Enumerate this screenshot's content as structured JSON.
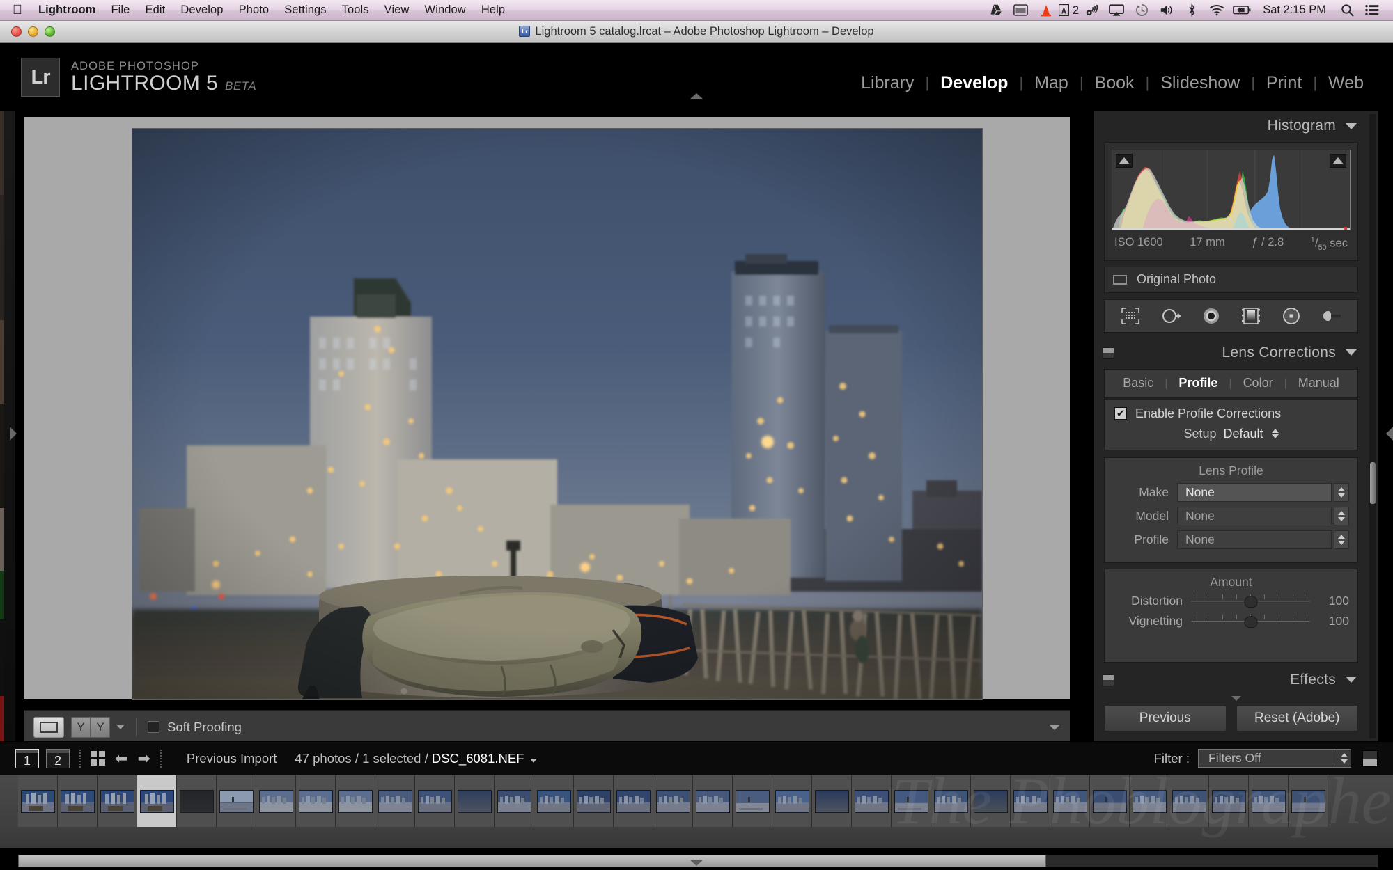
{
  "macbar": {
    "apple_icon": "apple-icon",
    "app_name": "Lightroom",
    "menus": [
      "File",
      "Edit",
      "Develop",
      "Photo",
      "Settings",
      "Tools",
      "View",
      "Window",
      "Help"
    ],
    "status_icons": [
      "google-drive-icon",
      "display-icon",
      "cone-icon",
      "adobe-icon",
      "airport-utility-icon",
      "airplay-icon",
      "time-machine-icon",
      "volume-icon",
      "bluetooth-icon",
      "wifi-icon",
      "battery-icon"
    ],
    "adobe_badge_count": "2",
    "clock": "Sat 2:15 PM",
    "search_icon": "search-icon",
    "notification_icon": "notification-list-icon"
  },
  "titlebar": {
    "title": "Lightroom 5 catalog.lrcat – Adobe Photoshop Lightroom – Develop",
    "close": "close-button",
    "minimize": "minimize-button",
    "zoom": "zoom-button"
  },
  "identity": {
    "badge": "Lr",
    "line1": "ADOBE PHOTOSHOP",
    "line2": "LIGHTROOM 5",
    "beta": "BETA"
  },
  "modules": {
    "items": [
      "Library",
      "Develop",
      "Map",
      "Book",
      "Slideshow",
      "Print",
      "Web"
    ],
    "active": "Develop"
  },
  "histogram": {
    "title": "Histogram",
    "iso": "ISO 1600",
    "focal": "17 mm",
    "aperture": "ƒ / 2.8",
    "shutter_num": "1",
    "shutter_den": "50",
    "shutter_unit": "sec",
    "shadow_clip": "shadow-clipping-toggle",
    "highlight_clip": "highlight-clipping-toggle"
  },
  "original_photo": {
    "label": "Original Photo"
  },
  "tools": {
    "items": [
      "crop-overlay-tool",
      "spot-removal-tool",
      "red-eye-correction-tool",
      "graduated-filter-tool",
      "radial-filter-tool",
      "adjustment-brush-tool"
    ]
  },
  "lens_corrections": {
    "title": "Lens Corrections",
    "tabs": [
      "Basic",
      "Profile",
      "Color",
      "Manual"
    ],
    "active_tab": "Profile",
    "enable_label": "Enable Profile Corrections",
    "enable_checked": true,
    "setup_label": "Setup",
    "setup_value": "Default",
    "lens_profile_title": "Lens Profile",
    "fields": [
      {
        "label": "Make",
        "value": "None"
      },
      {
        "label": "Model",
        "value": "None"
      },
      {
        "label": "Profile",
        "value": "None"
      }
    ],
    "amount_title": "Amount",
    "sliders": [
      {
        "label": "Distortion",
        "value": "100",
        "pos": 50
      },
      {
        "label": "Vignetting",
        "value": "100",
        "pos": 50
      }
    ]
  },
  "effects": {
    "title": "Effects"
  },
  "right_buttons": {
    "previous": "Previous",
    "reset": "Reset (Adobe)"
  },
  "toolbar": {
    "view_mode": "loupe-view-button",
    "before_after": [
      "Y",
      "Y"
    ],
    "soft_proofing_label": "Soft Proofing",
    "soft_proofing_checked": false
  },
  "filmstrip_bar": {
    "screen1": "1",
    "screen2": "2",
    "grid_icon": "grid-view-icon",
    "back_icon": "go-back-icon",
    "forward_icon": "go-forward-icon",
    "source": "Previous Import",
    "count": "47 photos / 1 selected / ",
    "filename": "DSC_6081.NEF",
    "filter_label": "Filter :",
    "filter_value": "Filters Off"
  },
  "filmstrip": {
    "selected_index": 3,
    "thumbs": [
      {
        "sky": "#2d4a74",
        "ground": "#6d7384",
        "kind": "city"
      },
      {
        "sky": "#2e4a78",
        "ground": "#5c6274",
        "kind": "city"
      },
      {
        "sky": "#2d4878",
        "ground": "#5a6072",
        "kind": "city"
      },
      {
        "sky": "#2d4878",
        "ground": "#5a6072",
        "kind": "city"
      },
      {
        "sky": "#232528",
        "ground": "#2a2c30",
        "kind": "dark"
      },
      {
        "sky": "#8c9ab0",
        "ground": "#6e7687",
        "kind": "pier"
      },
      {
        "sky": "#5b6e90",
        "ground": "#8e93a0",
        "kind": "skyline"
      },
      {
        "sky": "#5b6e90",
        "ground": "#8e93a0",
        "kind": "skyline"
      },
      {
        "sky": "#5b6e90",
        "ground": "#8e93a0",
        "kind": "skyline"
      },
      {
        "sky": "#4a5c7e",
        "ground": "#7e8493",
        "kind": "skyline"
      },
      {
        "sky": "#3e5178",
        "ground": "#6a707f",
        "kind": "skyline"
      },
      {
        "sky": "#2f3f5e",
        "ground": "#4c525f",
        "kind": "dark"
      },
      {
        "sky": "#3a4c70",
        "ground": "#7a8090",
        "kind": "skyline"
      },
      {
        "sky": "#39537f",
        "ground": "#707684",
        "kind": "skyline"
      },
      {
        "sky": "#2e4169",
        "ground": "#5f6574",
        "kind": "skyline"
      },
      {
        "sky": "#32456d",
        "ground": "#6a7080",
        "kind": "skyline"
      },
      {
        "sky": "#3d5175",
        "ground": "#767c8c",
        "kind": "skyline"
      },
      {
        "sky": "#46597c",
        "ground": "#7d8393",
        "kind": "skyline"
      },
      {
        "sky": "#4a5d80",
        "ground": "#828896",
        "kind": "pier"
      },
      {
        "sky": "#49628c",
        "ground": "#6e7484",
        "kind": "skyline"
      },
      {
        "sky": "#2a3a5c",
        "ground": "#4e545f",
        "kind": "dark"
      },
      {
        "sky": "#3b4f78",
        "ground": "#6f7583",
        "kind": "skyline"
      },
      {
        "sky": "#44597f",
        "ground": "#7a8090",
        "kind": "pier"
      },
      {
        "sky": "#3f5578",
        "ground": "#737988",
        "kind": "skyline"
      },
      {
        "sky": "#2b3c5e",
        "ground": "#4a5057",
        "kind": "dark"
      },
      {
        "sky": "#3c5178",
        "ground": "#767c8a",
        "kind": "skyline"
      },
      {
        "sky": "#41567d",
        "ground": "#7b8190",
        "kind": "skyline"
      },
      {
        "sky": "#3a4e74",
        "ground": "#6c727f",
        "kind": "pier"
      },
      {
        "sky": "#44597f",
        "ground": "#7d8392",
        "kind": "skyline"
      },
      {
        "sky": "#3e5276",
        "ground": "#757b89",
        "kind": "skyline"
      },
      {
        "sky": "#384c70",
        "ground": "#6b7180",
        "kind": "skyline"
      },
      {
        "sky": "#42567c",
        "ground": "#7a8090",
        "kind": "skyline"
      },
      {
        "sky": "#3d5175",
        "ground": "#71778a",
        "kind": "pier"
      }
    ]
  },
  "watermark": {
    "text": "The Phoblographer"
  },
  "colors": {
    "panel_bg": "#252525",
    "panel_inner": "#3a3a3a",
    "text_primary": "#d2d2d2",
    "text_muted": "#9c9c9c",
    "canvas_bg": "#a9a9a9",
    "accent_white": "#ffffff"
  }
}
